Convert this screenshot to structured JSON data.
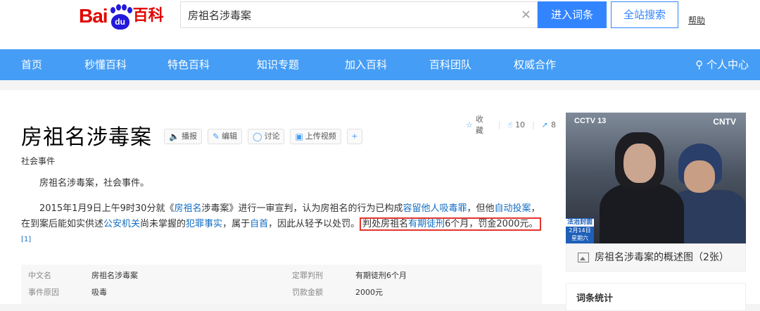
{
  "logo": {
    "bai": "Bai",
    "du": "du",
    "baike": "百科"
  },
  "search": {
    "value": "房祖名涉毒案",
    "clear": "×",
    "enter_label": "进入词条",
    "site_label": "全站搜索",
    "help": "帮助"
  },
  "nav": {
    "items": [
      "首页",
      "秒懂百科",
      "特色百科",
      "知识专题",
      "加入百科",
      "百科团队",
      "权威合作"
    ],
    "user": "个人中心"
  },
  "actions": {
    "collect": "收藏",
    "like_count": "10",
    "share_count": "8"
  },
  "page": {
    "title": "房祖名涉毒案",
    "subtitle": "社会事件",
    "tools": [
      "播报",
      "编辑",
      "讨论",
      "上传视频"
    ],
    "para1": "房祖名涉毒案，社会事件。",
    "para2": {
      "t1": "2015年1月9日上午9时30分就《",
      "l1": "房祖名",
      "t2": "涉毒案》进行一审宣判，认为房祖名的行为已构成",
      "l2": "容留他人吸毒罪",
      "t3": "，但他",
      "l3": "自动投案",
      "t4": "，在到案后能如实供述",
      "l4": "公安机关",
      "t5": "尚未掌握的",
      "l5": "犯罪事实",
      "t6": "，属于",
      "l6": "自首",
      "t7": "，因此从轻予以处罚。",
      "h1": "判处房祖名",
      "hl": "有期徒刑",
      "h2": "6个月，罚金2000元。",
      "ref": "[1]"
    },
    "info": [
      {
        "k1": "中文名",
        "v1": "房祖名涉毒案",
        "k2": "定罪判刑",
        "v2": "有期徒刑6个月"
      },
      {
        "k1": "事件原因",
        "v1": "吸毒",
        "k2": "罚款金额",
        "v2": "2000元"
      }
    ]
  },
  "side": {
    "pic_logo_left": "CCTV 13",
    "pic_logo_right": "CNTV",
    "pic_tag_title": "法治封面",
    "pic_tag_date": "2月14日",
    "pic_tag_day": "星期六",
    "caption": "房祖名涉毒案的概述图（2张）",
    "stats_title": "词条统计"
  }
}
